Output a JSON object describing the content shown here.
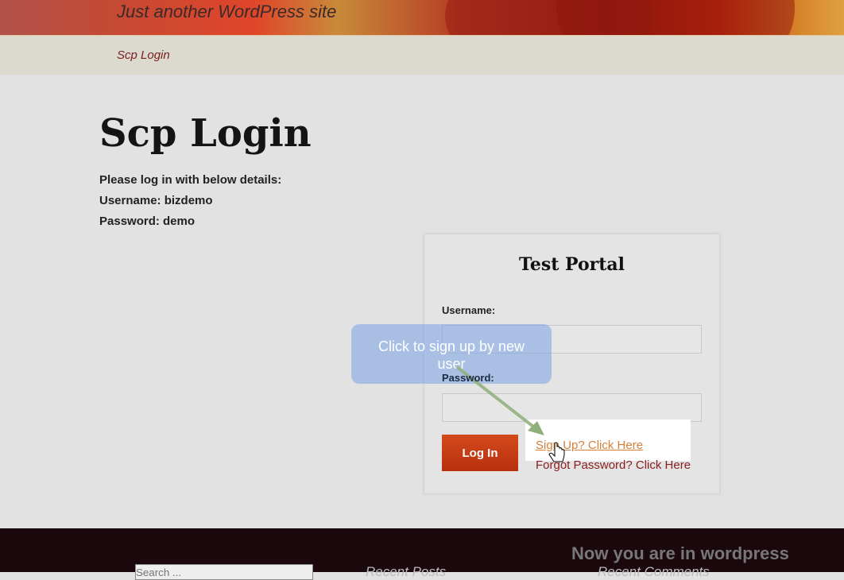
{
  "header": {
    "tagline": "Just another WordPress site"
  },
  "nav": {
    "items": [
      {
        "label": "Scp Login"
      }
    ]
  },
  "page": {
    "title": "Scp Login",
    "info": [
      "Please log in with below details:",
      "Username: bizdemo",
      "Password: demo"
    ]
  },
  "portal": {
    "title": "Test Portal",
    "username_label": "Username:",
    "username_value": "",
    "password_label": "Password:",
    "password_value": "",
    "login_button": "Log In",
    "signup_link": "Sign Up? Click Here",
    "forgot_link": "Forgot Password? Click Here"
  },
  "callout": {
    "text": "Click to sign up by new user"
  },
  "footer": {
    "overlay_text": "Now you are in wordpress",
    "search_placeholder": "Search ...",
    "widgets": [
      "Recent Posts",
      "Recent Comments"
    ]
  },
  "colors": {
    "accent": "#c0391a",
    "link": "#8a2020",
    "footer": "#1b080c"
  }
}
